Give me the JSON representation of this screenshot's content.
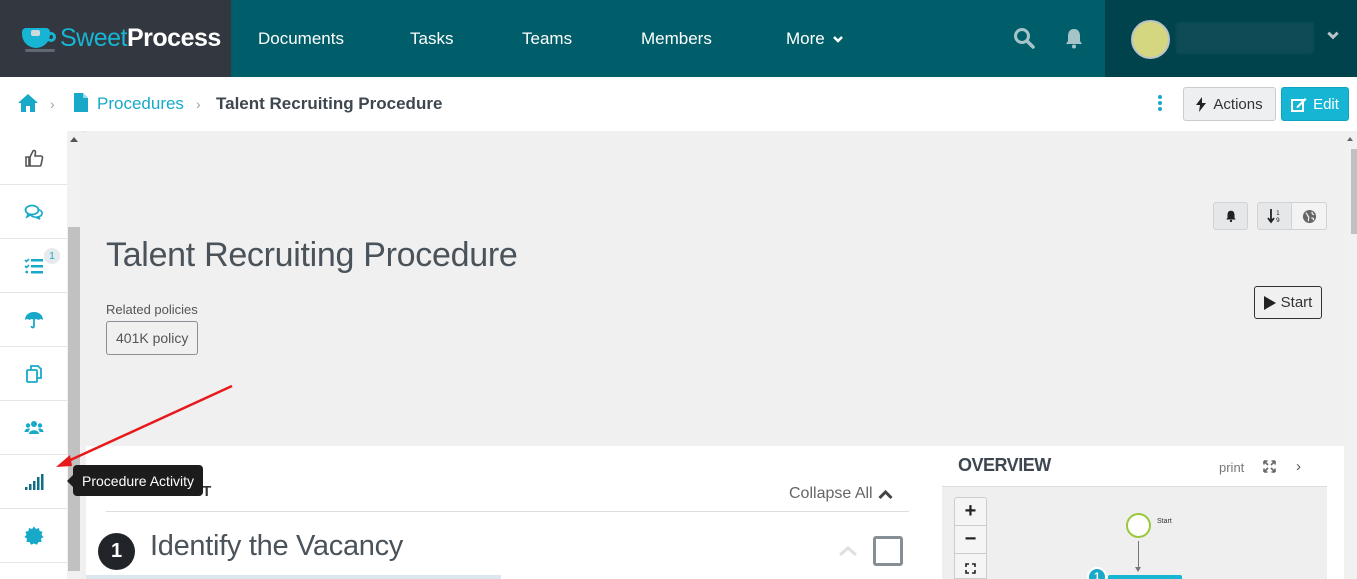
{
  "brand": {
    "name_part1": "Sweet",
    "name_part2": "Process"
  },
  "nav": {
    "items": [
      {
        "label": "Documents"
      },
      {
        "label": "Tasks"
      },
      {
        "label": "Teams"
      },
      {
        "label": "Members"
      },
      {
        "label": "More"
      }
    ],
    "icons": [
      "search-icon",
      "bell-icon"
    ],
    "user": {
      "avatar_color": "#d5d680"
    }
  },
  "breadcrumb": {
    "items": [
      {
        "label": "Procedures"
      },
      {
        "label": "Talent Recruiting Procedure"
      }
    ],
    "separator": "›"
  },
  "toolbar": {
    "actions_label": "Actions",
    "edit_label": "Edit"
  },
  "rail": {
    "items": [
      {
        "icon": "thumbs-up-icon",
        "label": "Approvals"
      },
      {
        "icon": "comments-icon",
        "label": "Comments"
      },
      {
        "icon": "tasks-icon",
        "label": "Tasks",
        "badge": "1"
      },
      {
        "icon": "umbrella-icon",
        "label": "Policies"
      },
      {
        "icon": "copy-icon",
        "label": "Copies"
      },
      {
        "icon": "users-icon",
        "label": "Members"
      },
      {
        "icon": "signal-icon",
        "label": "Procedure Activity"
      },
      {
        "icon": "certificate-icon",
        "label": "Certificate"
      }
    ]
  },
  "tooltip": {
    "text": "Procedure Activity"
  },
  "procedure": {
    "title": "Talent Recruiting Procedure",
    "related_label": "Related policies",
    "policies": [
      "401K policy"
    ],
    "start_label": "Start"
  },
  "steps": {
    "heading": "STEPS LIST",
    "collapse_label": "Collapse All",
    "items": [
      {
        "number": "1",
        "title": "Identify the Vacancy"
      }
    ]
  },
  "overview": {
    "title": "OVERVIEW",
    "print_label": "print",
    "next_label": "›",
    "zoom_in": "+",
    "zoom_out": "−",
    "flow_start_label": "Start",
    "flow_node_number": "1"
  },
  "colors": {
    "accent": "#17b5d4",
    "nav_bg": "#005e6a",
    "brand_bg": "#33373f",
    "user_bg": "#00434d"
  }
}
